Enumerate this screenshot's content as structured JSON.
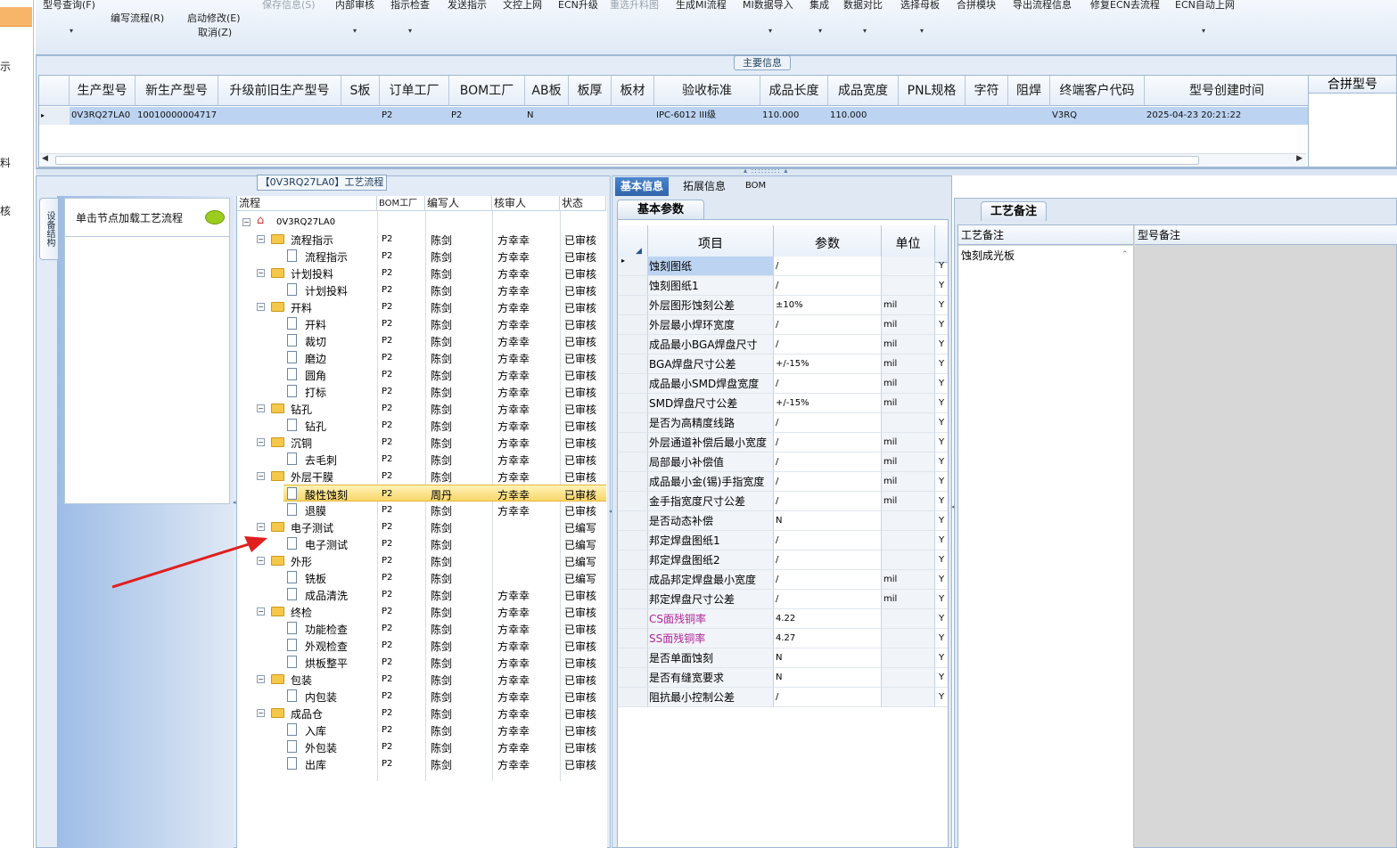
{
  "leftnav": {
    "items": [
      "示",
      "料",
      "核"
    ]
  },
  "toolbar": {
    "buttons": [
      {
        "label": "型号查询(F)",
        "dropdown": true
      },
      {
        "label": "编写流程(R)"
      },
      {
        "label": "启动修改(E)"
      },
      {
        "label": "取消(Z)"
      },
      {
        "label": "保存信息(S)",
        "disabled": true
      },
      {
        "label": "内部审核",
        "dropdown": true
      },
      {
        "label": "指示检查",
        "dropdown": true
      },
      {
        "label": "发送指示"
      },
      {
        "label": "文控上网"
      },
      {
        "label": "ECN升级"
      },
      {
        "label": "重选升料图",
        "disabled": true
      },
      {
        "label": "生成MI流程"
      },
      {
        "label": "MI数据导入",
        "dropdown": true
      },
      {
        "label": "集成",
        "dropdown": true
      },
      {
        "label": "数据对比",
        "dropdown": true
      },
      {
        "label": "选择母板",
        "dropdown": true
      },
      {
        "label": "合拼模块"
      },
      {
        "label": "导出流程信息"
      },
      {
        "label": "修复ECN去流程"
      },
      {
        "label": "ECN自动上网",
        "dropdown": true
      }
    ]
  },
  "main_info": {
    "title": "主要信息",
    "columns": [
      "生产型号",
      "新生产型号",
      "升级前旧生产型号",
      "S板",
      "订单工厂",
      "BOM工厂",
      "AB板",
      "板厚",
      "板材",
      "验收标准",
      "成品长度",
      "成品宽度",
      "PNL规格",
      "字符",
      "阻焊",
      "终端客户代码",
      "型号创建时间"
    ],
    "row": [
      "0V3RQ27LA0",
      "10010000004717",
      "",
      "",
      "P2",
      "P2",
      "N",
      "",
      "",
      "IPC-6012 III级",
      "110.000",
      "110.000",
      "",
      "",
      "",
      "V3RQ",
      "2025-04-23 20:21:22"
    ],
    "merge_header": "合拼型号"
  },
  "flow": {
    "title": "【0V3RQ27LA0】工艺流程",
    "side_tab": "设备结构",
    "node_hint": "单击节点加载工艺流程",
    "columns": [
      "流程",
      "BOM工厂",
      "编写人",
      "核审人",
      "状态"
    ],
    "root": "0V3RQ27LA0",
    "rows": [
      {
        "level": 1,
        "name": "流程指示",
        "bom": "P2",
        "writer": "陈剑",
        "reviewer": "方幸幸",
        "status": "已审核"
      },
      {
        "level": 2,
        "name": "流程指示",
        "bom": "P2",
        "writer": "陈剑",
        "reviewer": "方幸幸",
        "status": "已审核"
      },
      {
        "level": 1,
        "name": "计划投料",
        "bom": "P2",
        "writer": "陈剑",
        "reviewer": "方幸幸",
        "status": "已审核"
      },
      {
        "level": 2,
        "name": "计划投料",
        "bom": "P2",
        "writer": "陈剑",
        "reviewer": "方幸幸",
        "status": "已审核"
      },
      {
        "level": 1,
        "name": "开料",
        "bom": "P2",
        "writer": "陈剑",
        "reviewer": "方幸幸",
        "status": "已审核"
      },
      {
        "level": 2,
        "name": "开料",
        "bom": "P2",
        "writer": "陈剑",
        "reviewer": "方幸幸",
        "status": "已审核"
      },
      {
        "level": 2,
        "name": "裁切",
        "bom": "P2",
        "writer": "陈剑",
        "reviewer": "方幸幸",
        "status": "已审核"
      },
      {
        "level": 2,
        "name": "磨边",
        "bom": "P2",
        "writer": "陈剑",
        "reviewer": "方幸幸",
        "status": "已审核"
      },
      {
        "level": 2,
        "name": "圆角",
        "bom": "P2",
        "writer": "陈剑",
        "reviewer": "方幸幸",
        "status": "已审核"
      },
      {
        "level": 2,
        "name": "打标",
        "bom": "P2",
        "writer": "陈剑",
        "reviewer": "方幸幸",
        "status": "已审核"
      },
      {
        "level": 1,
        "name": "钻孔",
        "bom": "P2",
        "writer": "陈剑",
        "reviewer": "方幸幸",
        "status": "已审核"
      },
      {
        "level": 2,
        "name": "钻孔",
        "bom": "P2",
        "writer": "陈剑",
        "reviewer": "方幸幸",
        "status": "已审核"
      },
      {
        "level": 1,
        "name": "沉铜",
        "bom": "P2",
        "writer": "陈剑",
        "reviewer": "方幸幸",
        "status": "已审核"
      },
      {
        "level": 2,
        "name": "去毛刺",
        "bom": "P2",
        "writer": "陈剑",
        "reviewer": "方幸幸",
        "status": "已审核"
      },
      {
        "level": 1,
        "name": "外层干膜",
        "bom": "P2",
        "writer": "陈剑",
        "reviewer": "方幸幸",
        "status": "已审核"
      },
      {
        "level": 2,
        "name": "酸性蚀刻",
        "bom": "P2",
        "writer": "周丹",
        "reviewer": "方幸幸",
        "status": "已审核",
        "selected": true
      },
      {
        "level": 2,
        "name": "退膜",
        "bom": "P2",
        "writer": "陈剑",
        "reviewer": "方幸幸",
        "status": "已审核"
      },
      {
        "level": 1,
        "name": "电子测试",
        "bom": "P2",
        "writer": "陈剑",
        "reviewer": "",
        "status": "已编写"
      },
      {
        "level": 2,
        "name": "电子测试",
        "bom": "P2",
        "writer": "陈剑",
        "reviewer": "",
        "status": "已编写"
      },
      {
        "level": 1,
        "name": "外形",
        "bom": "P2",
        "writer": "陈剑",
        "reviewer": "",
        "status": "已编写"
      },
      {
        "level": 2,
        "name": "铣板",
        "bom": "P2",
        "writer": "陈剑",
        "reviewer": "",
        "status": "已编写"
      },
      {
        "level": 2,
        "name": "成品清洗",
        "bom": "P2",
        "writer": "陈剑",
        "reviewer": "方幸幸",
        "status": "已审核"
      },
      {
        "level": 1,
        "name": "终检",
        "bom": "P2",
        "writer": "陈剑",
        "reviewer": "方幸幸",
        "status": "已审核"
      },
      {
        "level": 2,
        "name": "功能检查",
        "bom": "P2",
        "writer": "陈剑",
        "reviewer": "方幸幸",
        "status": "已审核"
      },
      {
        "level": 2,
        "name": "外观检查",
        "bom": "P2",
        "writer": "陈剑",
        "reviewer": "方幸幸",
        "status": "已审核"
      },
      {
        "level": 2,
        "name": "烘板整平",
        "bom": "P2",
        "writer": "陈剑",
        "reviewer": "方幸幸",
        "status": "已审核"
      },
      {
        "level": 1,
        "name": "包装",
        "bom": "P2",
        "writer": "陈剑",
        "reviewer": "方幸幸",
        "status": "已审核"
      },
      {
        "level": 2,
        "name": "内包装",
        "bom": "P2",
        "writer": "陈剑",
        "reviewer": "方幸幸",
        "status": "已审核"
      },
      {
        "level": 1,
        "name": "成品仓",
        "bom": "P2",
        "writer": "陈剑",
        "reviewer": "方幸幸",
        "status": "已审核"
      },
      {
        "level": 2,
        "name": "入库",
        "bom": "P2",
        "writer": "陈剑",
        "reviewer": "方幸幸",
        "status": "已审核"
      },
      {
        "level": 2,
        "name": "外包装",
        "bom": "P2",
        "writer": "陈剑",
        "reviewer": "方幸幸",
        "status": "已审核"
      },
      {
        "level": 2,
        "name": "出库",
        "bom": "P2",
        "writer": "陈剑",
        "reviewer": "方幸幸",
        "status": "已审核"
      }
    ]
  },
  "detail_tabs": [
    "基本信息",
    "拓展信息",
    "BOM"
  ],
  "params": {
    "title": "基本参数",
    "columns": [
      "项目",
      "参数",
      "单位"
    ],
    "rows": [
      {
        "item": "蚀刻图纸",
        "value": "/",
        "unit": "",
        "flag": "Y"
      },
      {
        "item": "蚀刻图纸1",
        "value": "/",
        "unit": "",
        "flag": "Y"
      },
      {
        "item": "外层图形蚀刻公差",
        "value": "±10%",
        "unit": "mil",
        "flag": "Y"
      },
      {
        "item": "外层最小焊环宽度",
        "value": "/",
        "unit": "mil",
        "flag": "Y"
      },
      {
        "item": "成品最小BGA焊盘尺寸",
        "value": "/",
        "unit": "mil",
        "flag": "Y"
      },
      {
        "item": "BGA焊盘尺寸公差",
        "value": "+/-15%",
        "unit": "mil",
        "flag": "Y"
      },
      {
        "item": "成品最小SMD焊盘宽度",
        "value": "/",
        "unit": "mil",
        "flag": "Y"
      },
      {
        "item": "SMD焊盘尺寸公差",
        "value": "+/-15%",
        "unit": "mil",
        "flag": "Y"
      },
      {
        "item": "是否为高精度线路",
        "value": "/",
        "unit": "",
        "flag": "Y"
      },
      {
        "item": "外层通道补偿后最小宽度",
        "value": "/",
        "unit": "mil",
        "flag": "Y"
      },
      {
        "item": "局部最小补偿值",
        "value": "/",
        "unit": "mil",
        "flag": "Y"
      },
      {
        "item": "成品最小金(锡)手指宽度",
        "value": "/",
        "unit": "mil",
        "flag": "Y"
      },
      {
        "item": "金手指宽度尺寸公差",
        "value": "/",
        "unit": "mil",
        "flag": "Y"
      },
      {
        "item": "是否动态补偿",
        "value": "N",
        "unit": "",
        "flag": "Y"
      },
      {
        "item": "邦定焊盘图纸1",
        "value": "/",
        "unit": "",
        "flag": "Y"
      },
      {
        "item": "邦定焊盘图纸2",
        "value": "/",
        "unit": "",
        "flag": "Y"
      },
      {
        "item": "成品邦定焊盘最小宽度",
        "value": "/",
        "unit": "mil",
        "flag": "Y"
      },
      {
        "item": "邦定焊盘尺寸公差",
        "value": "/",
        "unit": "mil",
        "flag": "Y"
      },
      {
        "item": "CS面残铜率",
        "value": "4.22",
        "unit": "",
        "flag": "Y",
        "highlight": true
      },
      {
        "item": "SS面残铜率",
        "value": "4.27",
        "unit": "",
        "flag": "Y",
        "highlight": true
      },
      {
        "item": "是否单面蚀刻",
        "value": "N",
        "unit": "",
        "flag": "Y"
      },
      {
        "item": "是否有缝宽要求",
        "value": "N",
        "unit": "",
        "flag": "Y"
      },
      {
        "item": "阻抗最小控制公差",
        "value": "/",
        "unit": "",
        "flag": "Y"
      }
    ]
  },
  "remarks": {
    "title": "工艺备注",
    "columns": [
      "工艺备注",
      "型号备注"
    ],
    "process_remark": "蚀刻成光板"
  },
  "colors": {
    "selection": "#bcd4f1",
    "tab_active": "#2f64a8",
    "highlight_text": "#b0279b",
    "arrow": "#e01f1f"
  }
}
